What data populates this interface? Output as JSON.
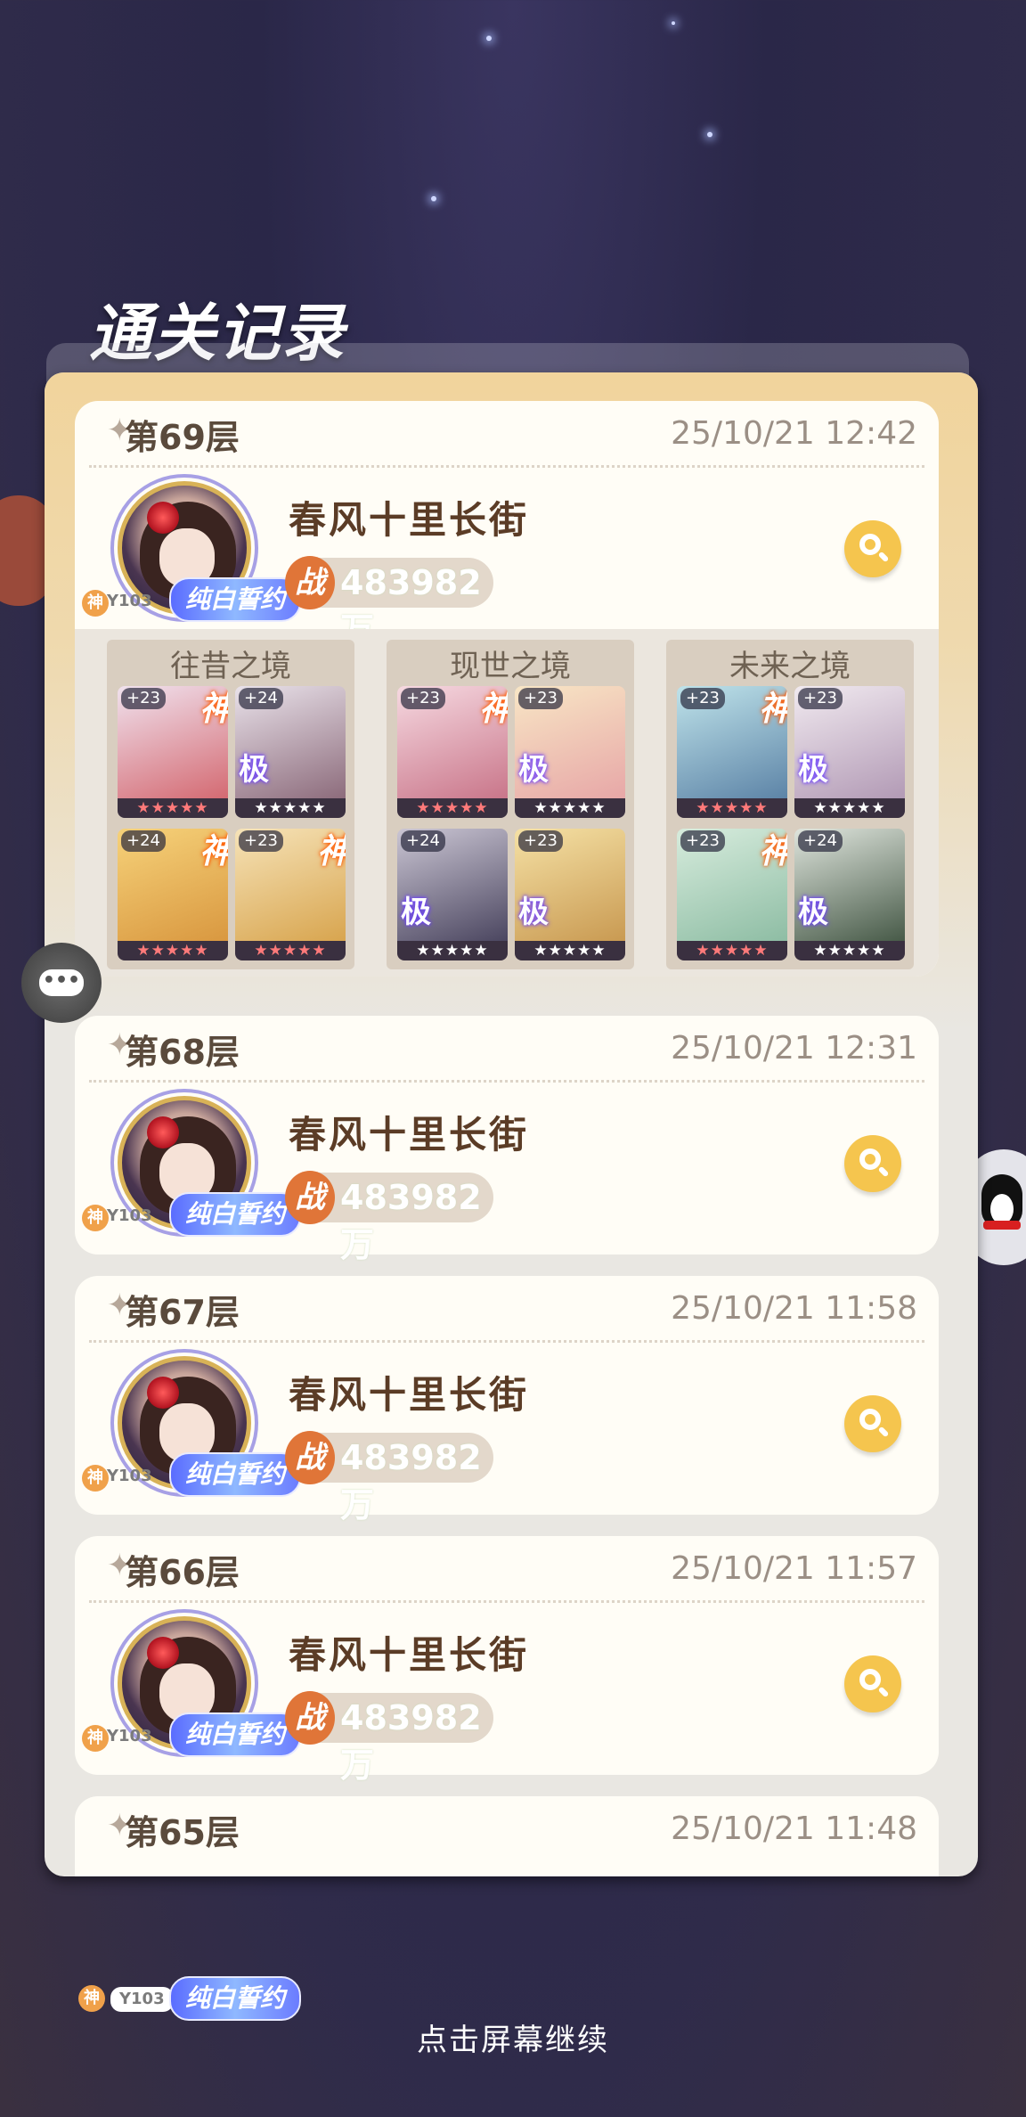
{
  "title": "通关记录",
  "hint": "点击屏幕继续",
  "records": [
    {
      "floor": "第69层",
      "time": "25/10/21 12:42",
      "name": "春风十里长街",
      "power": "483982万",
      "level": "Y103",
      "badge": "纯白誓约",
      "shen": "神",
      "zhan": "战"
    },
    {
      "floor": "第68层",
      "time": "25/10/21 12:31",
      "name": "春风十里长街",
      "power": "483982万",
      "level": "Y103",
      "badge": "纯白誓约",
      "shen": "神",
      "zhan": "战"
    },
    {
      "floor": "第67层",
      "time": "25/10/21 11:58",
      "name": "春风十里长街",
      "power": "483982万",
      "level": "Y103",
      "badge": "纯白誓约",
      "shen": "神",
      "zhan": "战"
    },
    {
      "floor": "第66层",
      "time": "25/10/21 11:57",
      "name": "春风十里长街",
      "power": "483982万",
      "level": "Y103",
      "badge": "纯白誓约",
      "shen": "神",
      "zhan": "战"
    },
    {
      "floor": "第65层",
      "time": "25/10/21 11:48"
    }
  ],
  "teams": [
    {
      "label": "往昔之境",
      "cards": [
        {
          "level": "+23",
          "tag": "神",
          "stars": "★★★★★",
          "art": [
            "#f0e2ee",
            "#d46a72"
          ]
        },
        {
          "level": "+24",
          "tag": "极",
          "stars": "★★★★★",
          "art": [
            "#e9e2ea",
            "#8d6c7c"
          ]
        },
        {
          "level": "+24",
          "tag": "神",
          "stars": "★★★★★",
          "art": [
            "#f6d27a",
            "#d99840"
          ]
        },
        {
          "level": "+23",
          "tag": "神",
          "stars": "★★★★★",
          "art": [
            "#f6e3b8",
            "#d8a54f"
          ]
        }
      ]
    },
    {
      "label": "现世之境",
      "cards": [
        {
          "level": "+23",
          "tag": "神",
          "stars": "★★★★★",
          "art": [
            "#f6d9e1",
            "#c9768a"
          ]
        },
        {
          "level": "+23",
          "tag": "极",
          "stars": "★★★★★",
          "art": [
            "#f8e6c5",
            "#e7a7a7"
          ]
        },
        {
          "level": "+24",
          "tag": "极",
          "stars": "★★★★★",
          "art": [
            "#cbc6d4",
            "#4b4660"
          ]
        },
        {
          "level": "+23",
          "tag": "极",
          "stars": "★★★★★",
          "art": [
            "#f5e1a5",
            "#c99a52"
          ]
        }
      ]
    },
    {
      "label": "未来之境",
      "cards": [
        {
          "level": "+23",
          "tag": "神",
          "stars": "★★★★★",
          "art": [
            "#bfe3ea",
            "#5d84a7"
          ]
        },
        {
          "level": "+23",
          "tag": "极",
          "stars": "★★★★★",
          "art": [
            "#f1eaf0",
            "#b29ab5"
          ]
        },
        {
          "level": "+23",
          "tag": "神",
          "stars": "★★★★★",
          "art": [
            "#d7ecdd",
            "#8ebda4"
          ]
        },
        {
          "level": "+24",
          "tag": "极",
          "stars": "★★★★★",
          "art": [
            "#dfe5dd",
            "#475a48"
          ]
        }
      ]
    }
  ],
  "bottom": {
    "level": "Y103",
    "badge": "纯白誓约",
    "shen": "神"
  },
  "chat_icon": "chat-bubble-icon",
  "colors": {
    "accent": "#f5c54e",
    "power": "#e07538",
    "panel": "#e9e7e2"
  }
}
